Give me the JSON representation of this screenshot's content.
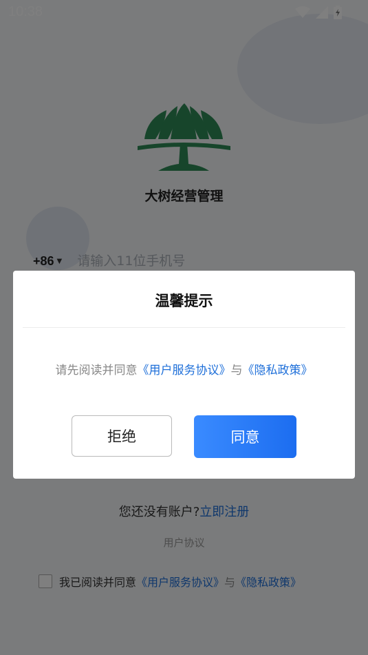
{
  "status_bar": {
    "time": "10:38",
    "icons": [
      "wifi-icon",
      "signal-icon",
      "battery-charging-icon"
    ]
  },
  "app": {
    "logo_icon": "tree-logo-icon",
    "name": "大树经营管理",
    "brand_color": "#2e8b57"
  },
  "login": {
    "country_code": "+86",
    "phone_placeholder": "请输入11位手机号",
    "phone_value": ""
  },
  "register": {
    "prompt": "您还没有账户?",
    "link": "立即注册"
  },
  "user_agreement_label": "用户协议",
  "agreement_row": {
    "checked": false,
    "prefix": "我已阅读并同意",
    "service_link": "《用户服务协议》",
    "connector": "与",
    "privacy_link": "《隐私政策》"
  },
  "dialog": {
    "title": "温馨提示",
    "message_prefix": "请先阅读并同意",
    "service_link": "《用户服务协议》",
    "connector": "与",
    "privacy_link": "《隐私政策》",
    "reject_label": "拒绝",
    "agree_label": "同意"
  },
  "colors": {
    "accent": "#1e6fd9",
    "button_gradient_start": "#3a8bff",
    "button_gradient_end": "#1c6df0"
  }
}
